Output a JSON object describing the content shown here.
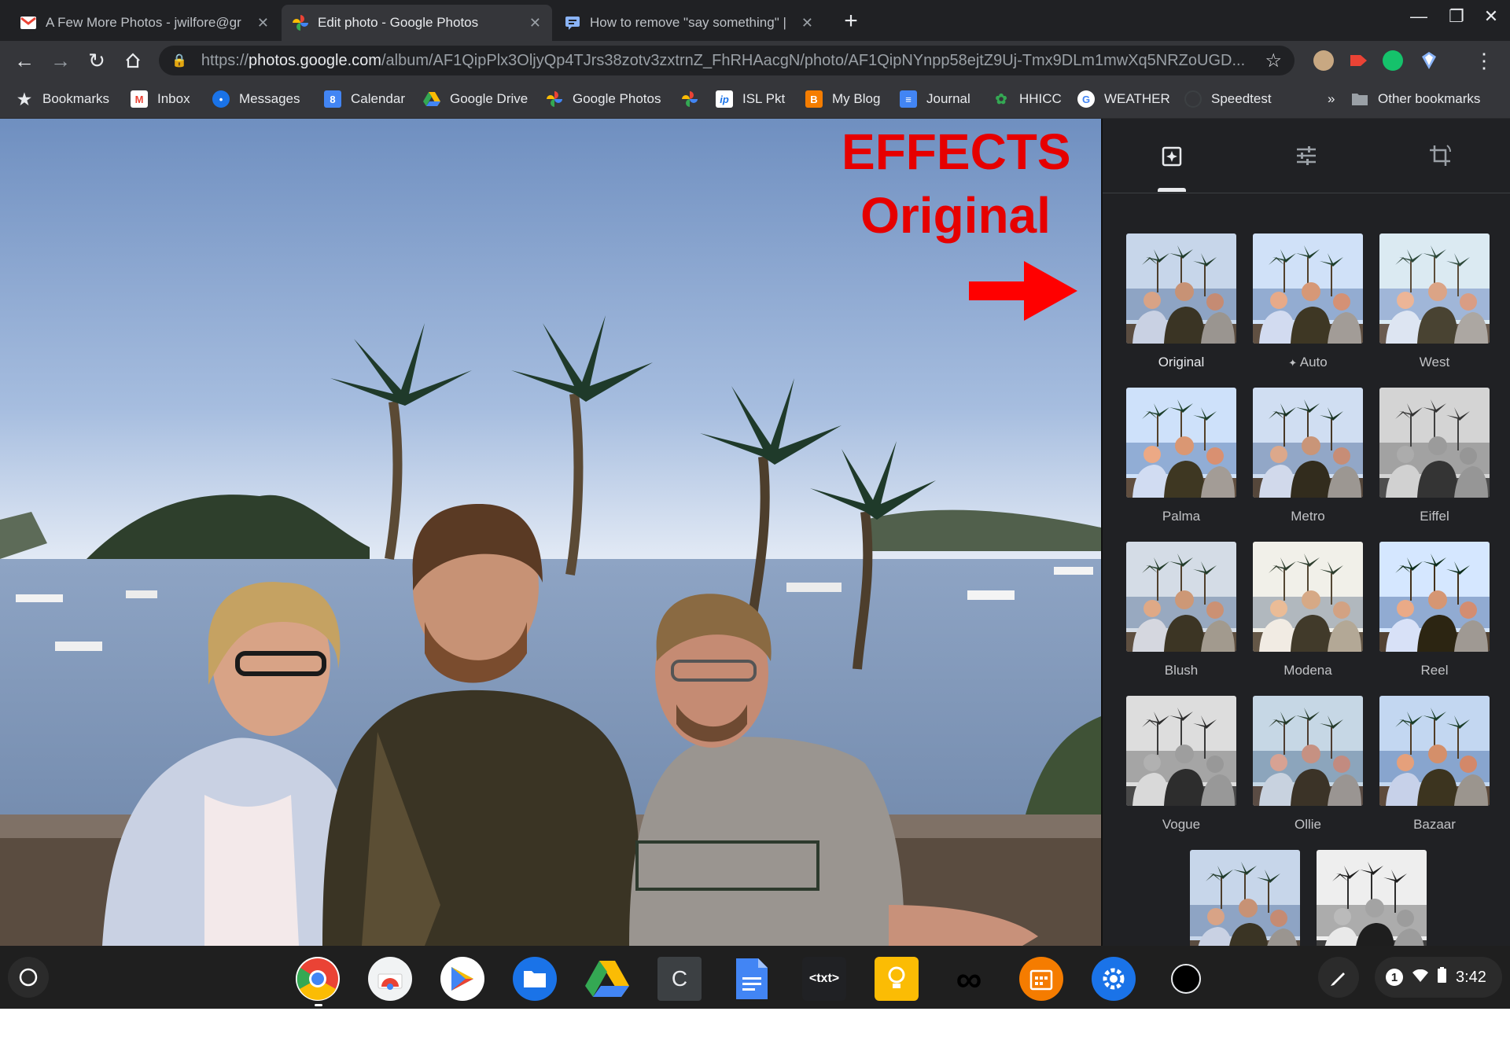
{
  "browser": {
    "tabs": [
      {
        "title": "A Few More Photos - jwilfore@gr",
        "active": false,
        "icon": "gmail-icon"
      },
      {
        "title": "Edit photo - Google Photos",
        "active": true,
        "icon": "google-photos-icon"
      },
      {
        "title": "How to remove \"say something\" |",
        "active": false,
        "icon": "chat-icon"
      }
    ],
    "new_tab_label": "+",
    "url_prefix": "https://",
    "url_host": "photos.google.com",
    "url_path": "/album/AF1QipPlx3OljyQp4TJrs38zotv3zxtrnZ_FhRHAacgN/photo/AF1QipNYnpp58ejtZ9Uj-Tmx9DLm1mwXq5NRZoUGD..."
  },
  "bookmarks": [
    {
      "label": "Bookmarks",
      "icon": "star-icon",
      "color": "#e8eaed"
    },
    {
      "label": "Inbox",
      "icon": "gmail-icon",
      "color": "#ea4335"
    },
    {
      "label": "Messages",
      "icon": "messages-icon",
      "color": "#1a73e8"
    },
    {
      "label": "Calendar",
      "icon": "calendar-icon",
      "color": "#4285f4"
    },
    {
      "label": "Google Drive",
      "icon": "drive-icon",
      "color": "#fbbc04"
    },
    {
      "label": "Google Photos",
      "icon": "google-photos-icon",
      "color": "#ea4335"
    },
    {
      "label": "",
      "icon": "pinwheel-icon",
      "color": "#ea4335"
    },
    {
      "label": "ISL Pkt",
      "icon": "ip-icon",
      "color": "#1a73e8"
    },
    {
      "label": "My Blog",
      "icon": "blogger-icon",
      "color": "#f57d00"
    },
    {
      "label": "Journal",
      "icon": "docs-icon",
      "color": "#4285f4"
    },
    {
      "label": "HHICC",
      "icon": "hhicc-icon",
      "color": "#34a853"
    },
    {
      "label": "WEATHER",
      "icon": "google-icon",
      "color": "#ffffff"
    },
    {
      "label": "Speedtest",
      "icon": "speedtest-icon",
      "color": "#3c4043"
    }
  ],
  "bookmarks_overflow": "»",
  "other_bookmarks": "Other bookmarks",
  "annotation": {
    "title": "EFFECTS",
    "subtitle": "Original",
    "arrow_color": "#ff0000"
  },
  "panel": {
    "tabs": [
      {
        "icon": "photo-filter-icon",
        "active": true
      },
      {
        "icon": "adjust-sliders-icon",
        "active": false
      },
      {
        "icon": "crop-rotate-icon",
        "active": false
      }
    ],
    "filters": [
      {
        "name": "Original",
        "selected": true
      },
      {
        "name": "Auto",
        "selected": false,
        "prefix_icon": "sparkle-icon"
      },
      {
        "name": "West",
        "selected": false
      },
      {
        "name": "Palma",
        "selected": false
      },
      {
        "name": "Metro",
        "selected": false
      },
      {
        "name": "Eiffel",
        "selected": false
      },
      {
        "name": "Blush",
        "selected": false
      },
      {
        "name": "Modena",
        "selected": false
      },
      {
        "name": "Reel",
        "selected": false
      },
      {
        "name": "Vogue",
        "selected": false
      },
      {
        "name": "Ollie",
        "selected": false
      },
      {
        "name": "Bazaar",
        "selected": false
      },
      {
        "name": "",
        "selected": false
      },
      {
        "name": "",
        "selected": false
      }
    ]
  },
  "shelf": {
    "apps": [
      {
        "icon": "chrome-icon"
      },
      {
        "icon": "chrome-web-store-icon"
      },
      {
        "icon": "play-store-icon"
      },
      {
        "icon": "files-icon"
      },
      {
        "icon": "google-drive-icon"
      },
      {
        "icon": "caret-app-icon",
        "label": "C"
      },
      {
        "icon": "google-docs-icon"
      },
      {
        "icon": "text-app-icon",
        "label": "<txt>"
      },
      {
        "icon": "keep-icon"
      },
      {
        "icon": "infinity-icon"
      },
      {
        "icon": "calendar-app-icon"
      },
      {
        "icon": "settings-icon"
      },
      {
        "icon": "circle-app-icon"
      }
    ],
    "notification_count": "1",
    "time": "3:42"
  }
}
